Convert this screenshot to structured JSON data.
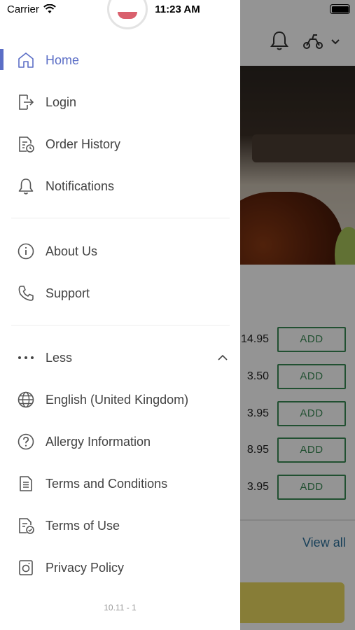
{
  "status_bar": {
    "carrier": "Carrier",
    "time": "11:23 AM"
  },
  "menu": {
    "active_color": "#5b6ec6",
    "items_top": [
      {
        "key": "home",
        "label": "Home",
        "icon": "home-icon",
        "active": true
      },
      {
        "key": "login",
        "label": "Login",
        "icon": "login-icon"
      },
      {
        "key": "order-history",
        "label": "Order History",
        "icon": "order-history-icon"
      },
      {
        "key": "notifications",
        "label": "Notifications",
        "icon": "bell-icon"
      }
    ],
    "items_mid": [
      {
        "key": "about-us",
        "label": "About Us",
        "icon": "info-icon"
      },
      {
        "key": "support",
        "label": "Support",
        "icon": "phone-icon"
      }
    ],
    "less_label": "Less",
    "items_more": [
      {
        "key": "language",
        "label": "English (United Kingdom)",
        "icon": "globe-icon"
      },
      {
        "key": "allergy",
        "label": "Allergy Information",
        "icon": "question-icon"
      },
      {
        "key": "terms-conditions",
        "label": "Terms and Conditions",
        "icon": "document-icon"
      },
      {
        "key": "terms-of-use",
        "label": "Terms of Use",
        "icon": "document-check-icon"
      },
      {
        "key": "privacy-policy",
        "label": "Privacy Policy",
        "icon": "privacy-icon"
      }
    ],
    "version": "10.11 - 1"
  },
  "background": {
    "rows": [
      {
        "price": "14.95",
        "button": "ADD"
      },
      {
        "price": "3.50",
        "button": "ADD"
      },
      {
        "price": "3.95",
        "button": "ADD"
      },
      {
        "price": "8.95",
        "button": "ADD"
      },
      {
        "price": "3.95",
        "button": "ADD"
      }
    ],
    "view_all": "View all",
    "add_color": "#3a8a55"
  }
}
